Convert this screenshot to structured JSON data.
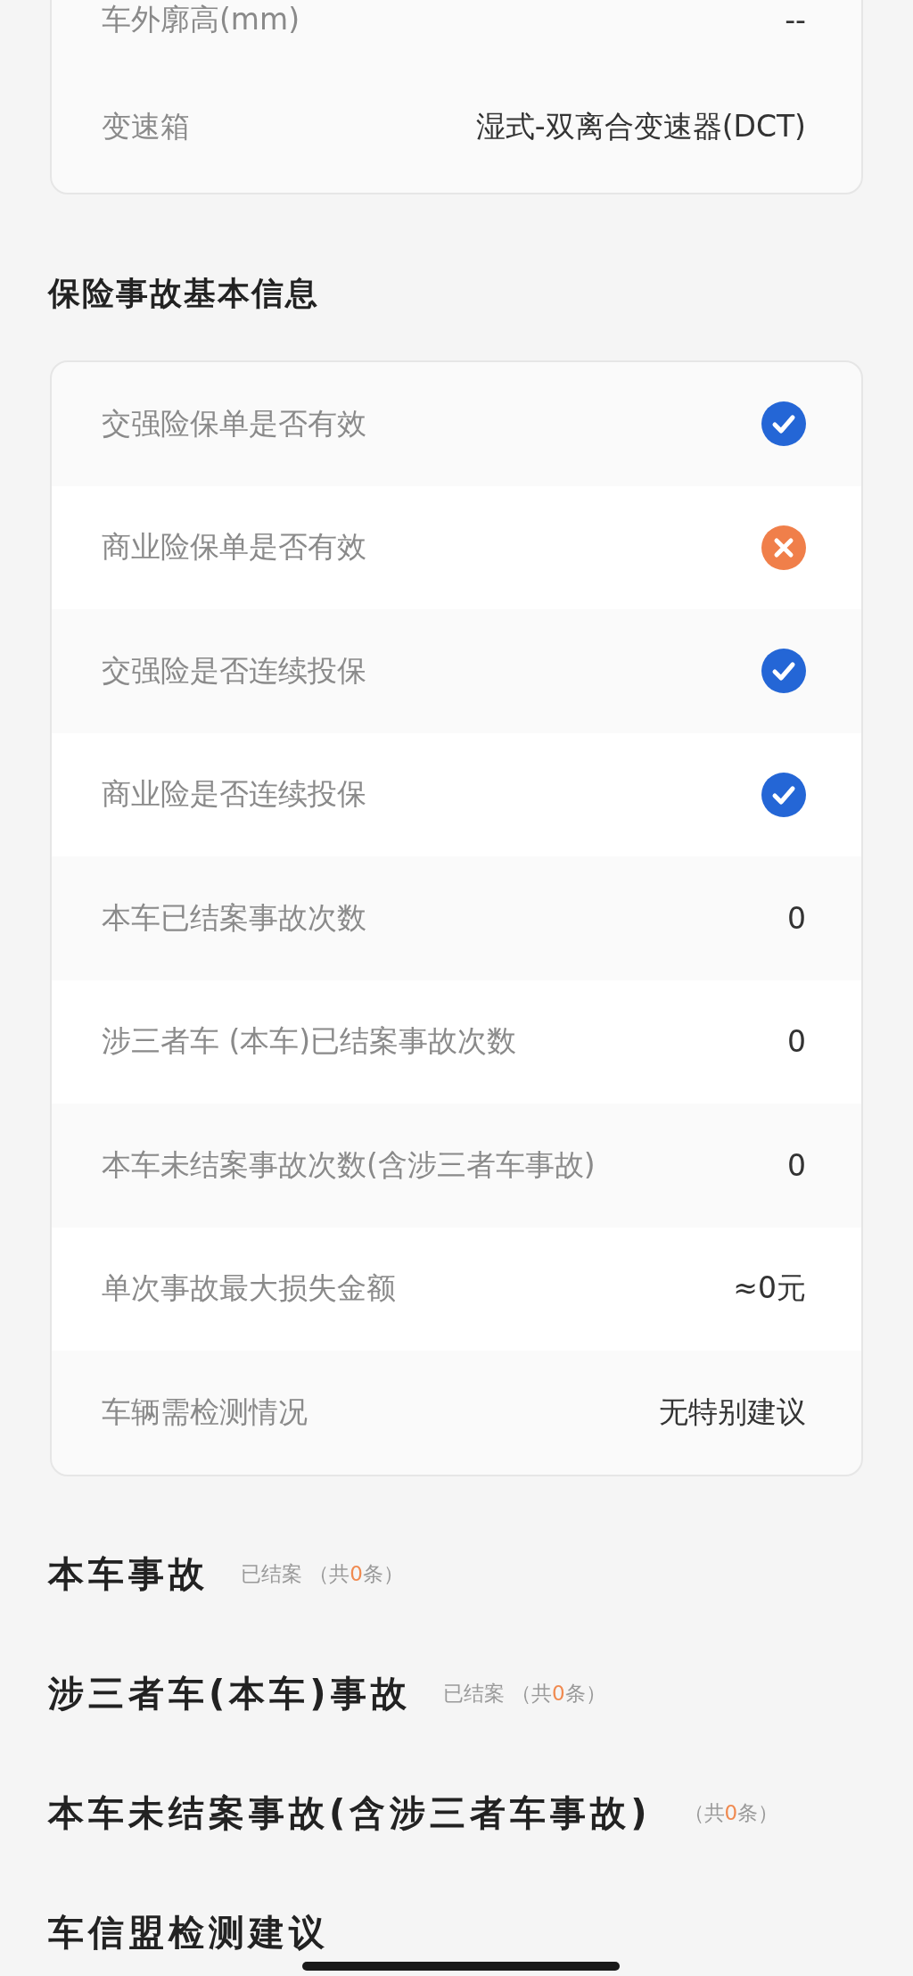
{
  "vehicle_card": {
    "rows": [
      {
        "label": "车外廓高(mm)",
        "value": "--"
      },
      {
        "label": "变速箱",
        "value": "湿式-双离合变速器(DCT)"
      }
    ]
  },
  "insurance_section": {
    "title": "保险事故基本信息",
    "rows": [
      {
        "kind": "status",
        "label": "交强险保单是否有效",
        "checked": true
      },
      {
        "kind": "status",
        "label": "商业险保单是否有效",
        "checked": false
      },
      {
        "kind": "status",
        "label": "交强险是否连续投保",
        "checked": true
      },
      {
        "kind": "status",
        "label": "商业险是否连续投保",
        "checked": true
      },
      {
        "kind": "text",
        "label": "本车已结案事故次数",
        "value": "0"
      },
      {
        "kind": "text",
        "label": "涉三者车 (本车)已结案事故次数",
        "value": "0"
      },
      {
        "kind": "text",
        "label": "本车未结案事故次数(含涉三者车事故)",
        "value": "0"
      },
      {
        "kind": "text",
        "label": "单次事故最大损失金额",
        "value": "≈0元"
      },
      {
        "kind": "text",
        "label": "车辆需检测情况",
        "value": "无特别建议"
      }
    ]
  },
  "accident_sections": [
    {
      "title": "本车事故",
      "status": "已结案",
      "count_prefix": "（共",
      "count": "0",
      "count_suffix": "条）"
    },
    {
      "title": "涉三者车(本车)事故",
      "status": "已结案",
      "count_prefix": "（共",
      "count": "0",
      "count_suffix": "条）"
    },
    {
      "title": "本车未结案事故(含涉三者车事故)",
      "count_prefix": "（共",
      "count": "0",
      "count_suffix": "条）"
    }
  ],
  "advice_section": {
    "title": "车信盟检测建议"
  }
}
